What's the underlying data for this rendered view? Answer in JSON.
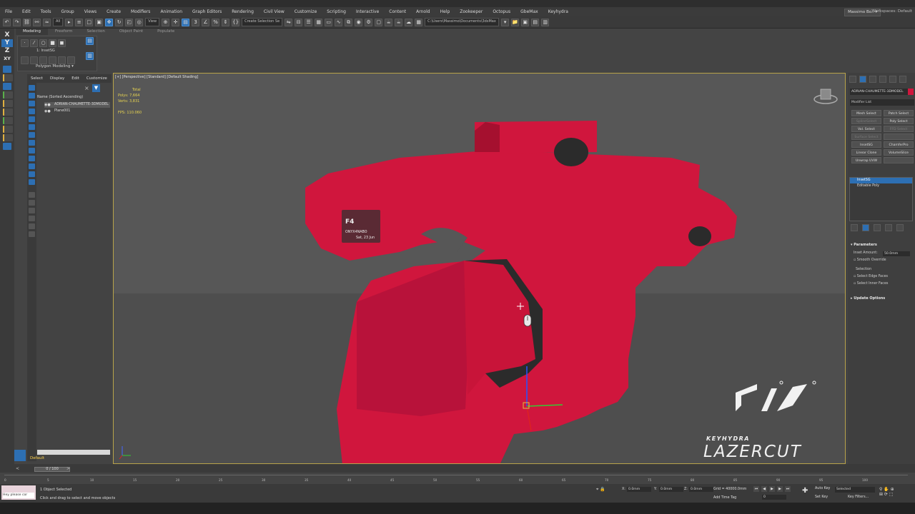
{
  "menu": [
    "File",
    "Edit",
    "Tools",
    "Group",
    "Views",
    "Create",
    "Modifiers",
    "Animation",
    "Graph Editors",
    "Rendering",
    "Civil View",
    "Customize",
    "Scripting",
    "Interactive",
    "Content",
    "Arnold",
    "Help",
    "Zookeeper",
    "Octopus",
    "GbeMax",
    "Keyhydra"
  ],
  "user": {
    "name": "Massimo Bo..",
    "workspaces_label": "Workspaces:",
    "workspace": "Default"
  },
  "toolbar": {
    "filter": "All",
    "ref_coord": "View",
    "selection_set": "Create Selection Se",
    "path": "C:\\Users\\Massimo\\Documents\\3dsMax"
  },
  "ribbon": {
    "tabs": [
      "Modeling",
      "Freeform",
      "Selection",
      "Object Paint",
      "Populate"
    ],
    "active_tab": "Modeling",
    "panel_label": "Polygon Modeling",
    "modifier_field": "1: InsetSG"
  },
  "axes": [
    "X",
    "Y",
    "Z",
    "XY"
  ],
  "scene_explorer": {
    "tabs": [
      "Select",
      "Display",
      "Edit",
      "Customize"
    ],
    "header": "Name (Sorted Ascending)",
    "rows": [
      {
        "name": "ADRIAN-CHAUMETTE-3DMODEL",
        "selected": true
      },
      {
        "name": "Plane001",
        "selected": false
      }
    ],
    "layer": "Default",
    "frame_slider": "0 / 100"
  },
  "viewport": {
    "label": "[+] [Perspective] [Standard] [Default Shading]",
    "stats": {
      "title": "Total",
      "polys_label": "Polys:",
      "polys": "7,664",
      "verts_label": "Verts:",
      "verts": "3,831",
      "fps_label": "FPS:",
      "fps": "110.060"
    },
    "tooltip": {
      "key": "F4",
      "name": "ONYX4NABO",
      "date": "Sat, 23 Jun"
    },
    "mesh_color": "#d0163d",
    "selection_border_color": "#b8a34a"
  },
  "command_panel": {
    "object_name": "ADRIAN-CHAUMETTE-3DMODEL",
    "object_color": "#d0163d",
    "modifier_list": "Modifier List",
    "modifier_buttons": [
      {
        "label": "Mesh Select",
        "enabled": true
      },
      {
        "label": "Patch Select",
        "enabled": true
      },
      {
        "label": "SplineSelect",
        "enabled": false
      },
      {
        "label": "Poly Select",
        "enabled": true
      },
      {
        "label": "Vol. Select",
        "enabled": true
      },
      {
        "label": "FFD Select",
        "enabled": false
      },
      {
        "label": "Surface Select",
        "enabled": false
      },
      {
        "label": "",
        "enabled": false
      },
      {
        "label": "InsetSG",
        "enabled": true
      },
      {
        "label": "ChamferPro",
        "enabled": true
      },
      {
        "label": "Linear Clone",
        "enabled": true
      },
      {
        "label": "VolumeSlice",
        "enabled": true
      },
      {
        "label": "Unwrap UVW",
        "enabled": true
      },
      {
        "label": "",
        "enabled": false
      }
    ],
    "stack": [
      {
        "name": "InsetSG",
        "selected": true
      },
      {
        "name": "Editable Poly",
        "selected": false
      }
    ],
    "parameters_title": "Parameters",
    "inset_amount_label": "Inset Amount:",
    "inset_amount": "50.0mm",
    "smooth_override": "Smooth Override",
    "selection_label": "Selection",
    "select_edge_faces": "Select Edge Faces",
    "select_inner_faces": "Select Inner Faces",
    "update_options": "Update Options"
  },
  "timeline": {
    "ticks": [
      "0",
      "5",
      "10",
      "15",
      "20",
      "25",
      "30",
      "35",
      "40",
      "45",
      "50",
      "55",
      "60",
      "65",
      "70",
      "75",
      "80",
      "85",
      "90",
      "95",
      "100"
    ]
  },
  "status": {
    "maxscript": "Hey please cor",
    "selected": "1 Object Selected",
    "prompt": "Click and drag to select and move objects",
    "x_label": "X:",
    "x": "0.0mm",
    "y_label": "Y:",
    "y": "0.0mm",
    "z_label": "Z:",
    "z": "0.0mm",
    "grid": "Grid = 40000.0mm",
    "add_time_tag": "Add Time Tag",
    "auto_key": "Auto Key",
    "set_key": "Set Key",
    "selected_set": "Selected",
    "key_filters": "Key Filters...",
    "frame": "0"
  },
  "brand": {
    "top": "KEYHYDRA",
    "bottom": "LAZERCUT"
  }
}
